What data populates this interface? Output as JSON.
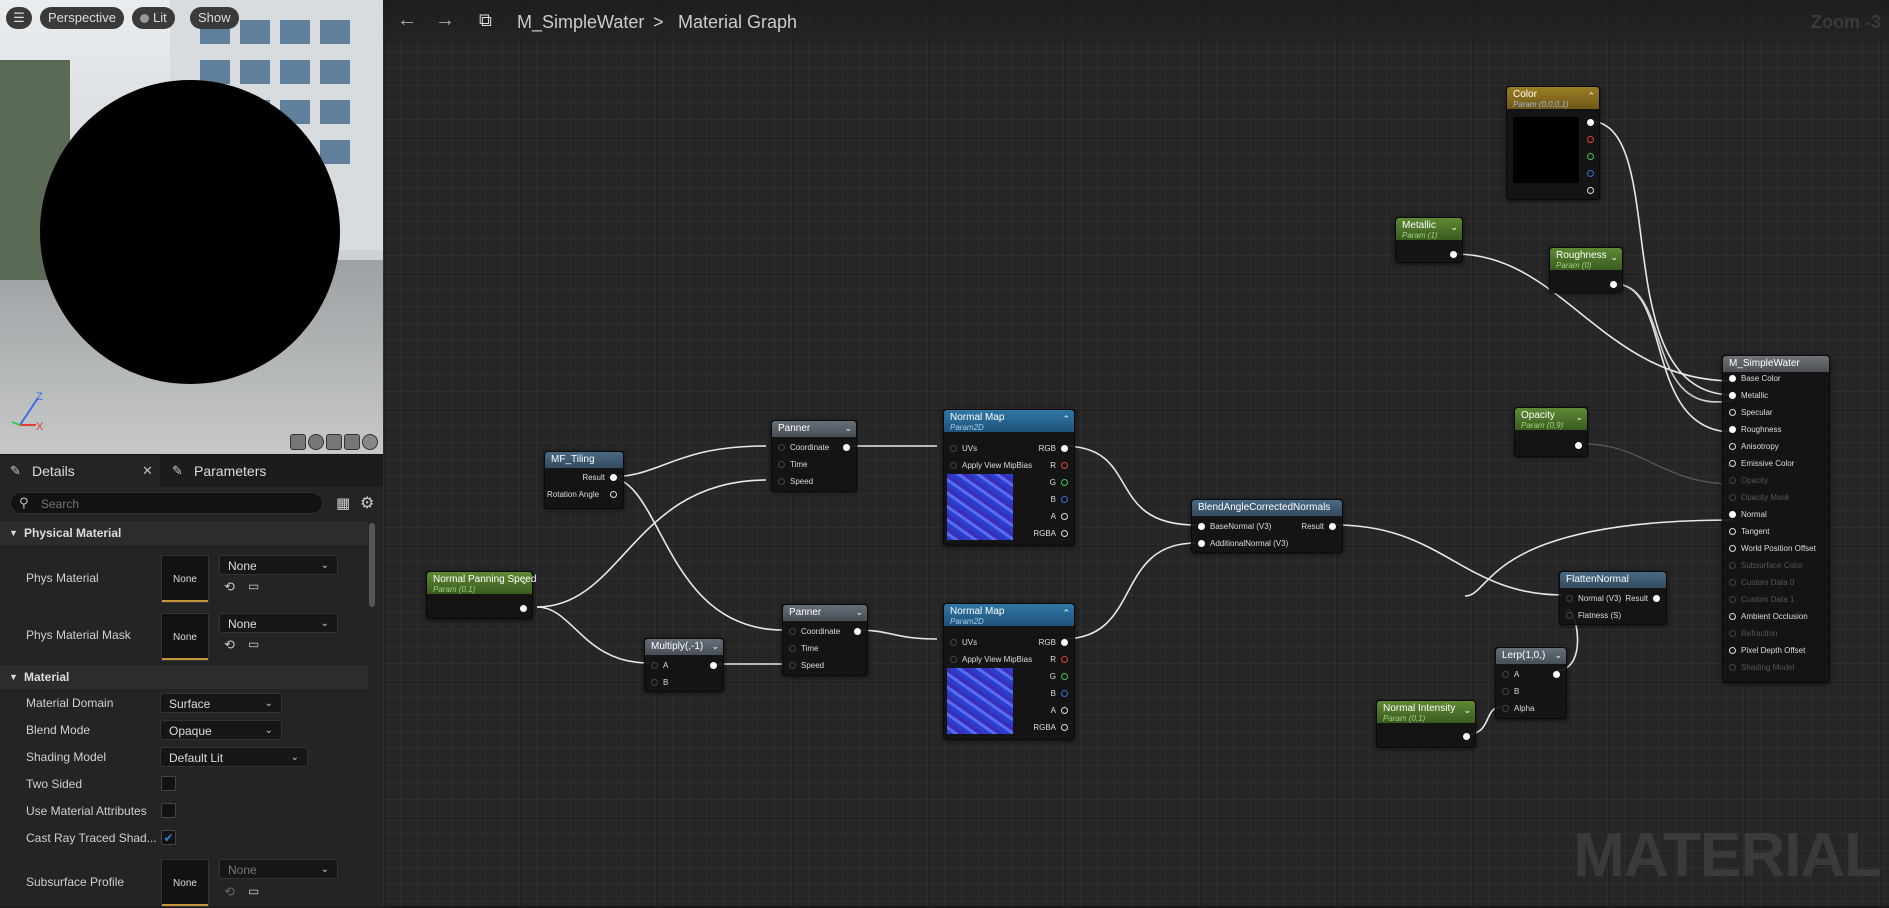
{
  "viewport": {
    "mode_label": "Perspective",
    "lit_label": "Lit",
    "show_label": "Show",
    "axis": {
      "z": "Z",
      "x": "X"
    }
  },
  "details": {
    "tab_details": "Details",
    "tab_parameters": "Parameters",
    "search_placeholder": "Search",
    "sections": {
      "physical": "Physical Material",
      "material": "Material"
    },
    "props": {
      "phys_material": "Phys Material",
      "phys_material_mask": "Phys Material Mask",
      "material_domain": "Material Domain",
      "blend_mode": "Blend Mode",
      "shading_model": "Shading Model",
      "two_sided": "Two Sided",
      "use_material_attributes": "Use Material Attributes",
      "cast_ray_traced": "Cast Ray Traced Shad...",
      "subsurface_profile": "Subsurface Profile"
    },
    "values": {
      "none": "None",
      "material_domain": "Surface",
      "blend_mode": "Opaque",
      "shading_model": "Default Lit",
      "two_sided": false,
      "use_material_attributes": false,
      "cast_ray_traced": true
    }
  },
  "graph": {
    "breadcrumb_asset": "M_SimpleWater",
    "breadcrumb_sep": ">",
    "breadcrumb_graph": "Material Graph",
    "zoom": "Zoom -3",
    "watermark": "MATERIAL",
    "nodes": {
      "color": {
        "title": "Color",
        "sub": "Param (0,0,0,1)"
      },
      "metallic": {
        "title": "Metallic",
        "sub": "Param (1)"
      },
      "roughness": {
        "title": "Roughness",
        "sub": "Param (0)"
      },
      "opacity": {
        "title": "Opacity",
        "sub": "Param (0,9)"
      },
      "result": {
        "title": "M_SimpleWater",
        "pins": [
          "Base Color",
          "Metallic",
          "Specular",
          "Roughness",
          "Anisotropy",
          "Emissive Color",
          "Opacity",
          "Opacity Mask",
          "Normal",
          "Tangent",
          "World Position Offset",
          "Subsurface Color",
          "Custom Data 0",
          "Custom Data 1",
          "Ambient Occlusion",
          "Refraction",
          "Pixel Depth Offset",
          "Shading Model"
        ],
        "dim": [
          false,
          false,
          false,
          false,
          false,
          false,
          true,
          true,
          false,
          false,
          false,
          true,
          true,
          true,
          false,
          true,
          false,
          true
        ]
      },
      "mf_tiling": {
        "title": "MF_Tiling",
        "result": "Result",
        "rotation": "Rotation Angle"
      },
      "panner1": {
        "title": "Panner",
        "coordinate": "Coordinate",
        "time": "Time",
        "speed": "Speed"
      },
      "panner2": {
        "title": "Panner",
        "coordinate": "Coordinate",
        "time": "Time",
        "speed": "Speed"
      },
      "normalmap1": {
        "title": "Normal Map",
        "sub": "Param2D",
        "uvs": "UVs",
        "mip": "Apply View MipBias",
        "rgb": "RGB",
        "r": "R",
        "g": "G",
        "b": "B",
        "a": "A",
        "rgba": "RGBA"
      },
      "normalmap2": {
        "title": "Normal Map",
        "sub": "Param2D",
        "uvs": "UVs",
        "mip": "Apply View MipBias",
        "rgb": "RGB",
        "r": "R",
        "g": "G",
        "b": "B",
        "a": "A",
        "rgba": "RGBA"
      },
      "panning_speed": {
        "title": "Normal Panning Speed",
        "sub": "Param (0,1)"
      },
      "multiply": {
        "title": "Multiply(,-1)",
        "a": "A",
        "b": "B"
      },
      "blend": {
        "title": "BlendAngleCorrectedNormals",
        "base": "BaseNormal (V3)",
        "additional": "AdditionalNormal (V3)",
        "result": "Result"
      },
      "flatten": {
        "title": "FlattenNormal",
        "normal": "Normal (V3)",
        "result": "Result",
        "flatness": "Flatness (S)"
      },
      "lerp": {
        "title": "Lerp(1,0,)",
        "a": "A",
        "b": "B",
        "alpha": "Alpha"
      },
      "normal_intensity": {
        "title": "Normal Intensity",
        "sub": "Param (0,1)"
      }
    }
  }
}
